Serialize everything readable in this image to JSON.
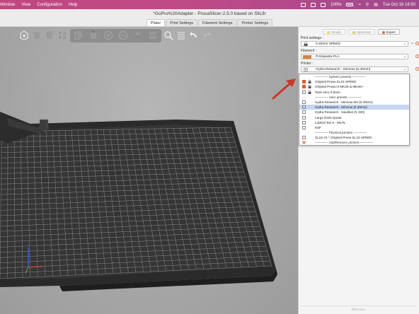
{
  "menubar": {
    "items": [
      "Window",
      "View",
      "Configuration",
      "Help"
    ],
    "battery": "100%",
    "clock": "Tue Oct 18  16:50"
  },
  "window": {
    "title": "*GoPro%20Adapter - PrusaSlicer-2.5.0 based on Slic3r"
  },
  "tabs": [
    {
      "label": "Plater",
      "active": true
    },
    {
      "label": "Print Settings",
      "active": false
    },
    {
      "label": "Filament Settings",
      "active": false
    },
    {
      "label": "Printer Settings",
      "active": false
    }
  ],
  "toolbar": {
    "icons": [
      "add-icon",
      "delete-icon",
      "delete-all-icon",
      "arrange-icon",
      "copy-icon",
      "paste-icon",
      "add-instance-icon",
      "remove-instance-icon",
      "split-objects-icon",
      "split-parts-icon",
      "search-icon",
      "layers-icon",
      "undo-icon",
      "redo-icon"
    ]
  },
  "sidebar": {
    "modes": [
      {
        "label": "Simple",
        "dot": "#e8d46a",
        "active": false
      },
      {
        "label": "Advanced",
        "dot": "#d7d07a",
        "active": false
      },
      {
        "label": "Expert",
        "dot": "#e06a3b",
        "active": true
      }
    ],
    "print_settings": {
      "label": "Print settings :",
      "value": "0.20mm SPEED"
    },
    "filament": {
      "label": "Filament :",
      "value": "Protopasta PLA",
      "color": "#e0823a"
    },
    "printer": {
      "label": "Printer :",
      "value": "Hydra Research - Minnow (0.40mm)"
    },
    "slice_label": "Slice now"
  },
  "dropdown": {
    "items": [
      {
        "label": "———— System presets ————",
        "type": "sep"
      },
      {
        "label": "Original Prusa SL1S SPEED",
        "type": "system",
        "icon": "prusa"
      },
      {
        "label": "Original Prusa i3 MK3S & MK3S+",
        "type": "system",
        "icon": "prusa"
      },
      {
        "label": "Taz6 Aero 0.5mm",
        "type": "system",
        "icon": "generic"
      },
      {
        "label": "———— User presets ————",
        "type": "sep"
      },
      {
        "label": "Hydra Research - Minnow  M2 (0.40mm)",
        "type": "user"
      },
      {
        "label": "Hydra Research - Minnow (0.40mm)",
        "type": "user",
        "selected": true
      },
      {
        "label": "Hydra Research - Nautilus (X 400)",
        "type": "user"
      },
      {
        "label": "Large Parts Quote",
        "type": "user"
      },
      {
        "label": "Lulzbot Taz 6 - M175",
        "type": "user"
      },
      {
        "label": "MJF",
        "type": "user"
      },
      {
        "label": "———— Physical printers ————",
        "type": "sep"
      },
      {
        "label": "SL1S #1 * Original Prusa SL1S SPEED",
        "type": "physical"
      },
      {
        "label": "———— Add/Remove printers ————",
        "type": "add"
      }
    ]
  },
  "colors": {
    "accent_arrow": "#c9382a",
    "selection": "#c4d7f2",
    "bed": "#353535",
    "grid": "#8a8a8a"
  }
}
